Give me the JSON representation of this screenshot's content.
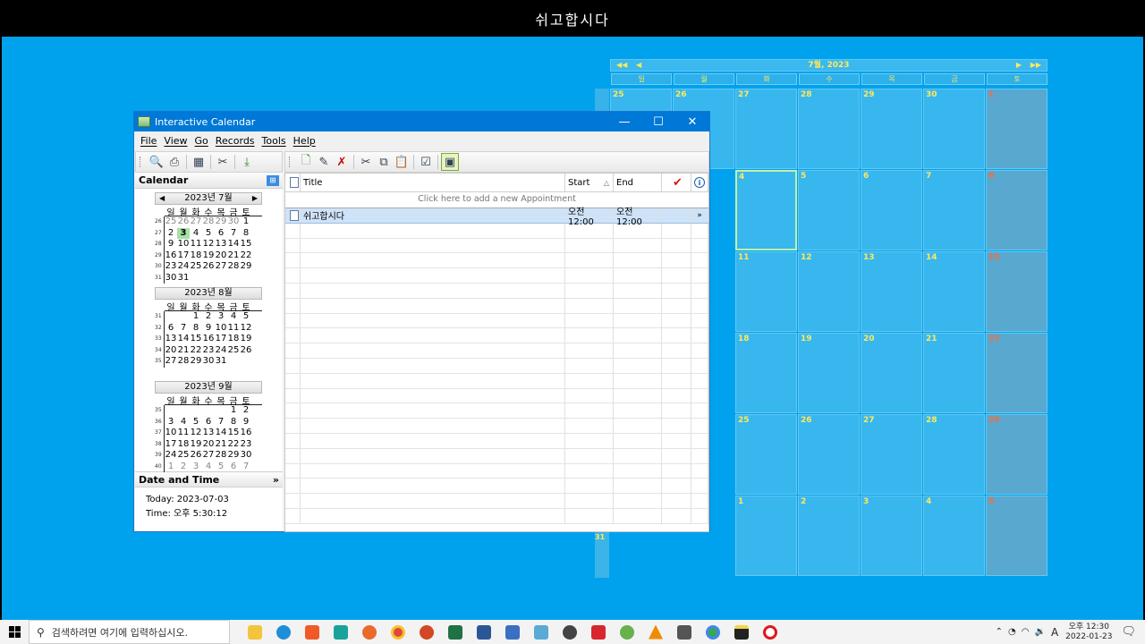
{
  "top_bar": {
    "title": "쉬고합시다"
  },
  "desktop_calendar": {
    "month_label": "7월, 2023",
    "weekdays": [
      "일",
      "월",
      "화",
      "수",
      "목",
      "금",
      "토"
    ],
    "week_label": "31",
    "rows": [
      [
        "25",
        "26",
        "27",
        "28",
        "29",
        "30",
        "1"
      ],
      [
        "",
        "",
        "",
        "4",
        "5",
        "6",
        "7",
        "8"
      ],
      [
        "",
        "",
        "",
        "11",
        "12",
        "13",
        "14",
        "15"
      ],
      [
        "",
        "",
        "",
        "18",
        "19",
        "20",
        "21",
        "22"
      ],
      [
        "",
        "",
        "",
        "25",
        "26",
        "27",
        "28",
        "29"
      ],
      [
        "",
        "",
        "",
        "1",
        "2",
        "3",
        "4",
        "5"
      ]
    ]
  },
  "window": {
    "title": "Interactive Calendar",
    "menu": [
      "File",
      "View",
      "Go",
      "Records",
      "Tools",
      "Help"
    ],
    "calendar_panel_title": "Calendar",
    "months": [
      {
        "title": "2023년 7월",
        "dow": [
          "일",
          "월",
          "화",
          "수",
          "목",
          "금",
          "토"
        ],
        "weeks": [
          {
            "wn": "26",
            "days": [
              "25",
              "26",
              "27",
              "28",
              "29",
              "30",
              "1"
            ]
          },
          {
            "wn": "27",
            "days": [
              "2",
              "3",
              "4",
              "5",
              "6",
              "7",
              "8"
            ]
          },
          {
            "wn": "28",
            "days": [
              "9",
              "10",
              "11",
              "12",
              "13",
              "14",
              "15"
            ]
          },
          {
            "wn": "29",
            "days": [
              "16",
              "17",
              "18",
              "19",
              "20",
              "21",
              "22"
            ]
          },
          {
            "wn": "30",
            "days": [
              "23",
              "24",
              "25",
              "26",
              "27",
              "28",
              "29"
            ]
          },
          {
            "wn": "31",
            "days": [
              "30",
              "31",
              "",
              "",
              "",
              "",
              ""
            ]
          }
        ]
      },
      {
        "title": "2023년 8월",
        "dow": [
          "일",
          "월",
          "화",
          "수",
          "목",
          "금",
          "토"
        ],
        "weeks": [
          {
            "wn": "31",
            "days": [
              "",
              "",
              "1",
              "2",
              "3",
              "4",
              "5"
            ]
          },
          {
            "wn": "32",
            "days": [
              "6",
              "7",
              "8",
              "9",
              "10",
              "11",
              "12"
            ]
          },
          {
            "wn": "33",
            "days": [
              "13",
              "14",
              "15",
              "16",
              "17",
              "18",
              "19"
            ]
          },
          {
            "wn": "34",
            "days": [
              "20",
              "21",
              "22",
              "23",
              "24",
              "25",
              "26"
            ]
          },
          {
            "wn": "35",
            "days": [
              "27",
              "28",
              "29",
              "30",
              "31",
              "",
              ""
            ]
          }
        ]
      },
      {
        "title": "2023년 9월",
        "dow": [
          "일",
          "월",
          "화",
          "수",
          "목",
          "금",
          "토"
        ],
        "weeks": [
          {
            "wn": "35",
            "days": [
              "",
              "",
              "",
              "",
              "",
              "1",
              "2"
            ]
          },
          {
            "wn": "36",
            "days": [
              "3",
              "4",
              "5",
              "6",
              "7",
              "8",
              "9"
            ]
          },
          {
            "wn": "37",
            "days": [
              "10",
              "11",
              "12",
              "13",
              "14",
              "15",
              "16"
            ]
          },
          {
            "wn": "38",
            "days": [
              "17",
              "18",
              "19",
              "20",
              "21",
              "22",
              "23"
            ]
          },
          {
            "wn": "39",
            "days": [
              "24",
              "25",
              "26",
              "27",
              "28",
              "29",
              "30"
            ]
          },
          {
            "wn": "40",
            "days": [
              "1",
              "2",
              "3",
              "4",
              "5",
              "6",
              "7"
            ]
          }
        ]
      }
    ],
    "date_time_title": "Date and Time",
    "today": "Today: 2023-07-03",
    "time": "Time: 오후 5:30:12",
    "columns": {
      "title": "Title",
      "start": "Start",
      "end": "End"
    },
    "add_prompt": "Click here to add a new Appointment",
    "appointment": {
      "title": "쉬고합시다",
      "start": "오전 12:00",
      "end": "오전 12:00"
    }
  },
  "taskbar": {
    "search_placeholder": "검색하려면 여기에 입력하십시오.",
    "tray_lang": "A",
    "clock_time": "오후 12:30",
    "clock_date": "2022-01-23"
  },
  "colors": {
    "desktop": "#00a2ed",
    "titlebar": "#0078d7",
    "accent_yellow": "#ffe95a"
  }
}
